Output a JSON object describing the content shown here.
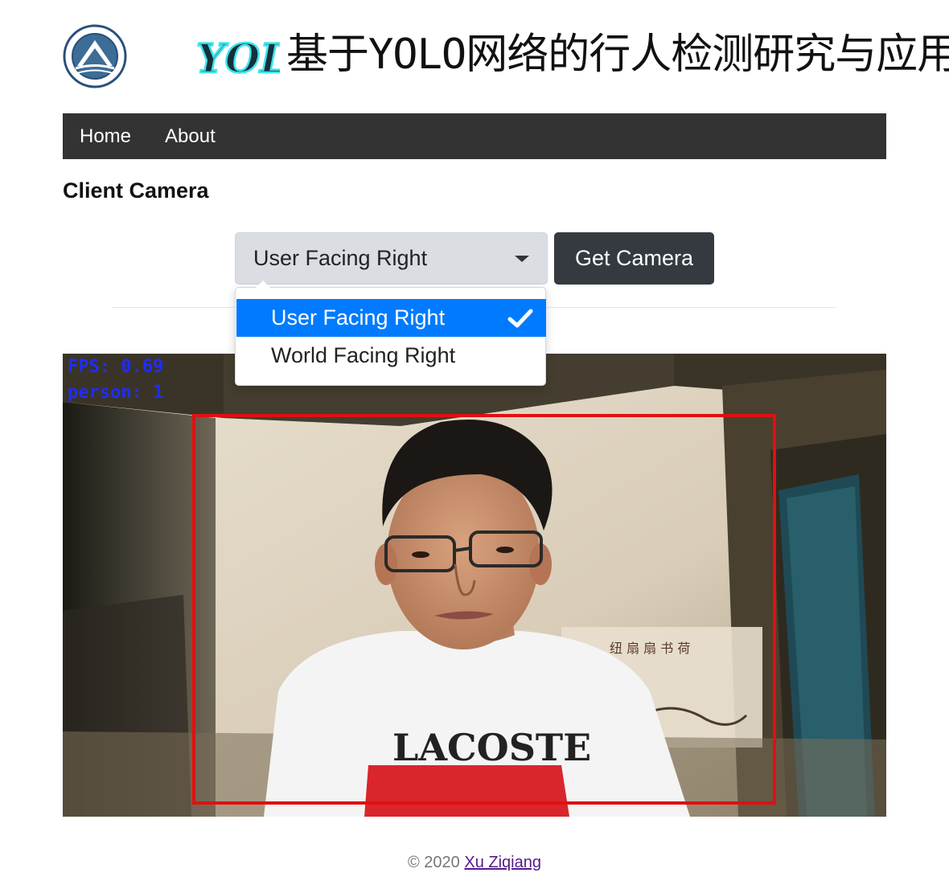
{
  "header": {
    "title": "基于YOLO网络的行人检测研究与应用",
    "logo_icon": "university-seal-icon",
    "yolo_logo_icon": "yolo-logo-icon"
  },
  "nav": {
    "items": [
      {
        "label": "Home"
      },
      {
        "label": "About"
      }
    ]
  },
  "page": {
    "section_title": "Client Camera"
  },
  "controls": {
    "select_value": "User Facing Right",
    "button_label": "Get Camera"
  },
  "dropdown": {
    "options": [
      {
        "label": "User Facing Right",
        "selected": true
      },
      {
        "label": "World Facing Right",
        "selected": false
      }
    ]
  },
  "video": {
    "fps_text": "FPS: 0.69",
    "person_text": "person: 1",
    "box_color": "#e01010",
    "overlay_color": "#1f2cff"
  },
  "footer": {
    "copyright": "© 2020 ",
    "author": "Xu Ziqiang"
  },
  "colors": {
    "navbar_bg": "#333333",
    "accent": "#007bff",
    "button_dark": "#343a40"
  }
}
